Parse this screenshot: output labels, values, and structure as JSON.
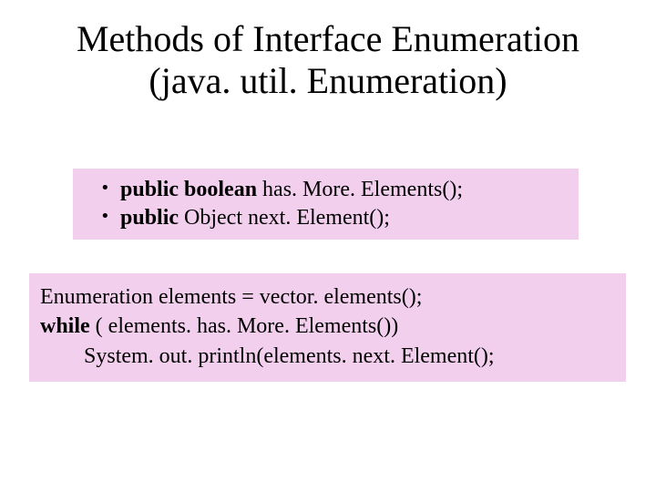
{
  "title_line1": "Methods of Interface Enumeration",
  "title_line2": "(java. util. Enumeration)",
  "methods": {
    "line1_kw": "public boolean",
    "line1_rest": " has. More. Elements();",
    "line2_kw": "public",
    "line2_rest": " Object next. Element();"
  },
  "code": {
    "line1_a": "Enumeration elements = vector. elements();",
    "line2_kw": "while",
    "line2_rest": " ( elements. has. More. Elements())",
    "line3": "System. out. println(elements. next. Element();"
  }
}
